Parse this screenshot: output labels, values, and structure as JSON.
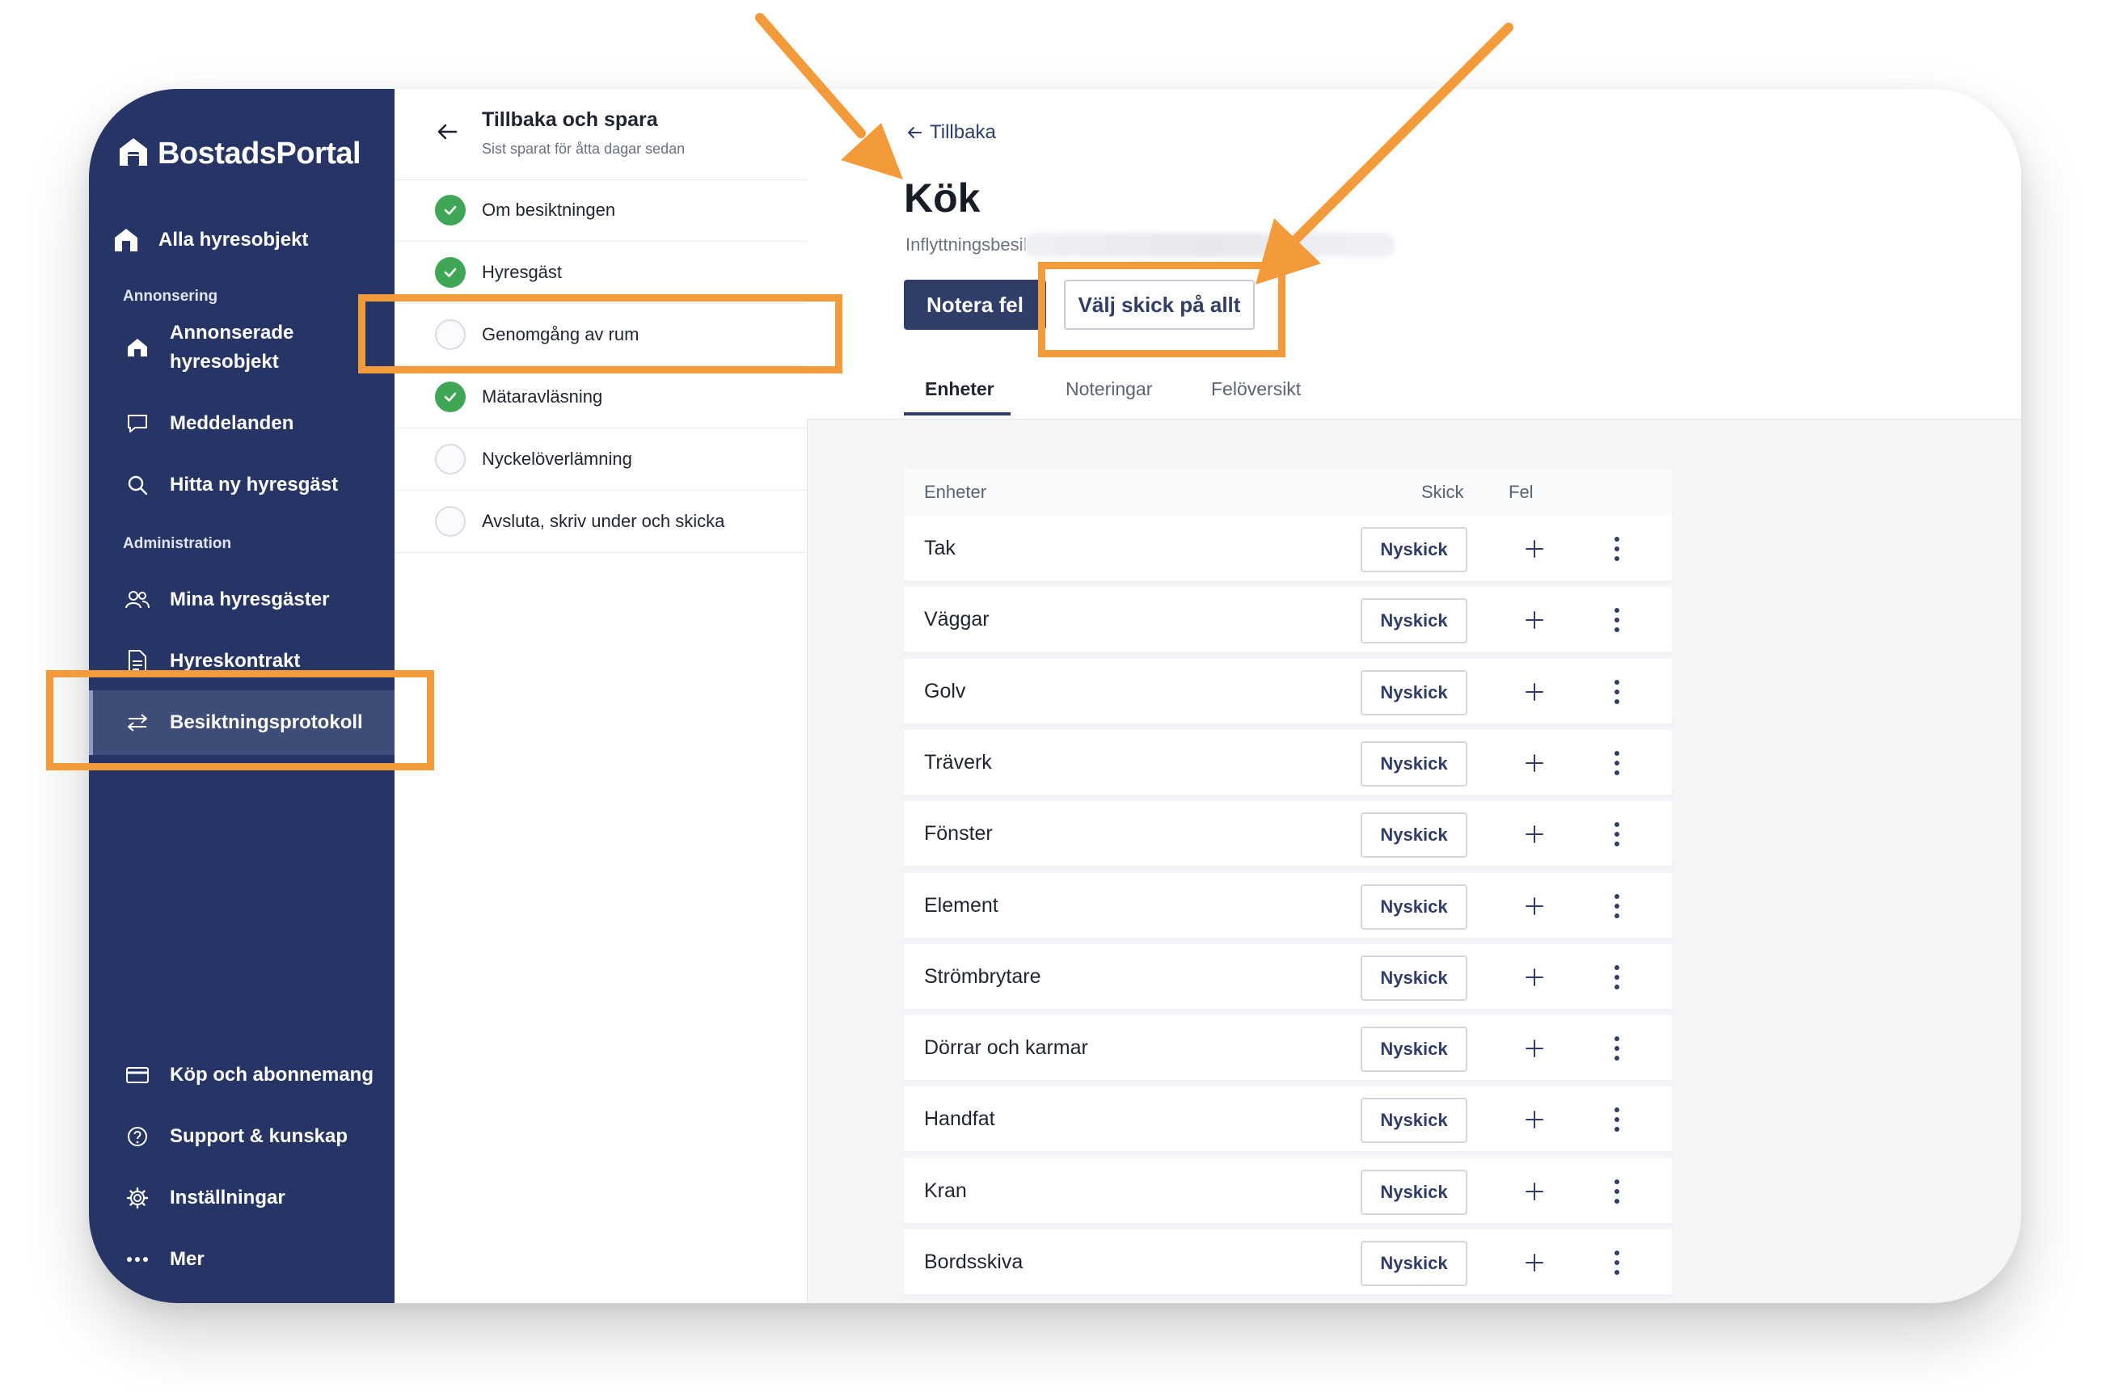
{
  "app": {
    "brand": "BostadsPortal",
    "accent": "#263565",
    "highlight_color": "#f39a3a"
  },
  "sidebar": {
    "top_item": {
      "label": "Alla hyresobjekt",
      "icon": "home-icon"
    },
    "section_annonsering": "Annonsering",
    "annonsering_items": [
      {
        "label": "Annonserade hyresobjekt",
        "icon": "house-icon"
      },
      {
        "label": "Meddelanden",
        "icon": "chat-bubble-icon"
      },
      {
        "label": "Hitta ny hyresgäst",
        "icon": "search-icon"
      }
    ],
    "section_administration": "Administration",
    "administration_items": [
      {
        "label": "Mina hyresgäster",
        "icon": "users-icon"
      },
      {
        "label": "Hyreskontrakt",
        "icon": "document-icon"
      },
      {
        "label": "Besiktningsprotokoll",
        "icon": "swap-arrows-icon",
        "active": true
      }
    ],
    "bottom_items": [
      {
        "label": "Köp och abonnemang",
        "icon": "credit-card-icon"
      },
      {
        "label": "Support & kunskap",
        "icon": "help-icon"
      },
      {
        "label": "Inställningar",
        "icon": "gear-icon"
      },
      {
        "label": "Mer",
        "icon": "more-dots-icon"
      }
    ]
  },
  "steps_panel": {
    "back_title": "Tillbaka och spara",
    "saved_text": "Sist sparat för åtta dagar sedan",
    "steps": [
      {
        "label": "Om besiktningen",
        "done": true
      },
      {
        "label": "Hyresgäst",
        "done": true
      },
      {
        "label": "Genomgång av rum",
        "done": false
      },
      {
        "label": "Mätaravläsning",
        "done": true
      },
      {
        "label": "Nyckelöverlämning",
        "done": false
      },
      {
        "label": "Avsluta, skriv under och skicka",
        "done": false
      }
    ]
  },
  "main": {
    "back_label": "Tillbaka",
    "title": "Kök",
    "subtitle": "Inflyttningsbesiktning -",
    "primary_button": "Notera fel",
    "secondary_button": "Välj skick på allt",
    "tabs": [
      "Enheter",
      "Noteringar",
      "Felöversikt"
    ],
    "active_tab": "Enheter",
    "table": {
      "headers": {
        "unit": "Enheter",
        "condition": "Skick",
        "error": "Fel"
      },
      "rows": [
        {
          "name": "Tak",
          "condition": "Nyskick"
        },
        {
          "name": "Väggar",
          "condition": "Nyskick"
        },
        {
          "name": "Golv",
          "condition": "Nyskick"
        },
        {
          "name": "Träverk",
          "condition": "Nyskick"
        },
        {
          "name": "Fönster",
          "condition": "Nyskick"
        },
        {
          "name": "Element",
          "condition": "Nyskick"
        },
        {
          "name": "Strömbrytare",
          "condition": "Nyskick"
        },
        {
          "name": "Dörrar och karmar",
          "condition": "Nyskick"
        },
        {
          "name": "Handfat",
          "condition": "Nyskick"
        },
        {
          "name": "Kran",
          "condition": "Nyskick"
        },
        {
          "name": "Bordsskiva",
          "condition": "Nyskick"
        }
      ]
    }
  }
}
